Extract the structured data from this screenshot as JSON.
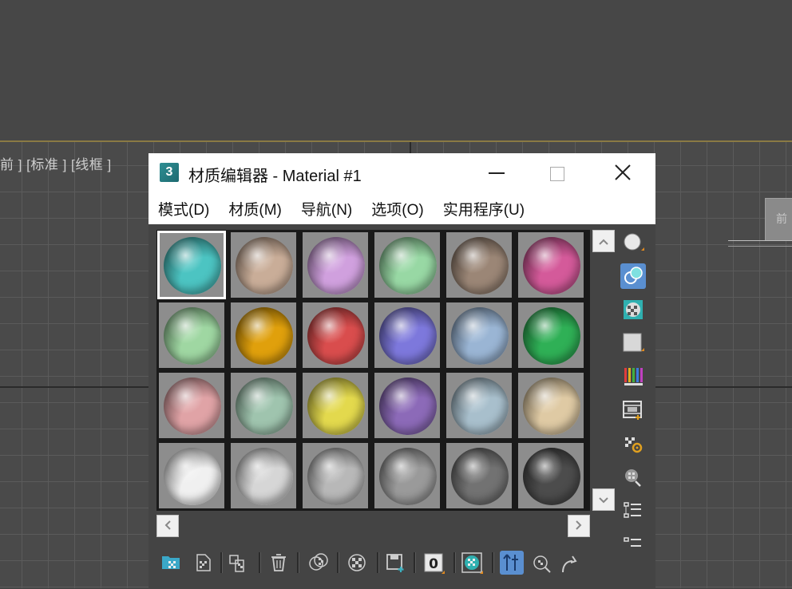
{
  "viewport": {
    "label": "前 ] [标准 ] [线框 ]",
    "viewcube_label": "前"
  },
  "editor": {
    "app_icon_text": "3",
    "title": "材质编辑器 - Material #1",
    "menu": [
      {
        "label": "模式(D)"
      },
      {
        "label": "材质(M)"
      },
      {
        "label": "导航(N)"
      },
      {
        "label": "选项(O)"
      },
      {
        "label": "实用程序(U)"
      }
    ],
    "sample_slots": [
      {
        "color": "#4cc4c2"
      },
      {
        "color": "#c9ad98"
      },
      {
        "color": "#d0a0de"
      },
      {
        "color": "#98d8a4"
      },
      {
        "color": "#9b8676"
      },
      {
        "color": "#d45a9a"
      },
      {
        "color": "#9fd7a2"
      },
      {
        "color": "#e0a00c"
      },
      {
        "color": "#d94d4d"
      },
      {
        "color": "#7d78dc"
      },
      {
        "color": "#9ab5d4"
      },
      {
        "color": "#2fb056"
      },
      {
        "color": "#e0a3a6"
      },
      {
        "color": "#9fc4ae"
      },
      {
        "color": "#e3d94d"
      },
      {
        "color": "#8c6ab8"
      },
      {
        "color": "#a8bfcc"
      },
      {
        "color": "#dfcaa4"
      },
      {
        "color": "#f0f0f0"
      },
      {
        "color": "#d6d6d6"
      },
      {
        "color": "#b8b8b8"
      },
      {
        "color": "#9a9a9a"
      },
      {
        "color": "#727272"
      },
      {
        "color": "#4c4c4c"
      }
    ],
    "active_slot": "Material #1",
    "bottom_toolbar_reset_label": "0"
  }
}
